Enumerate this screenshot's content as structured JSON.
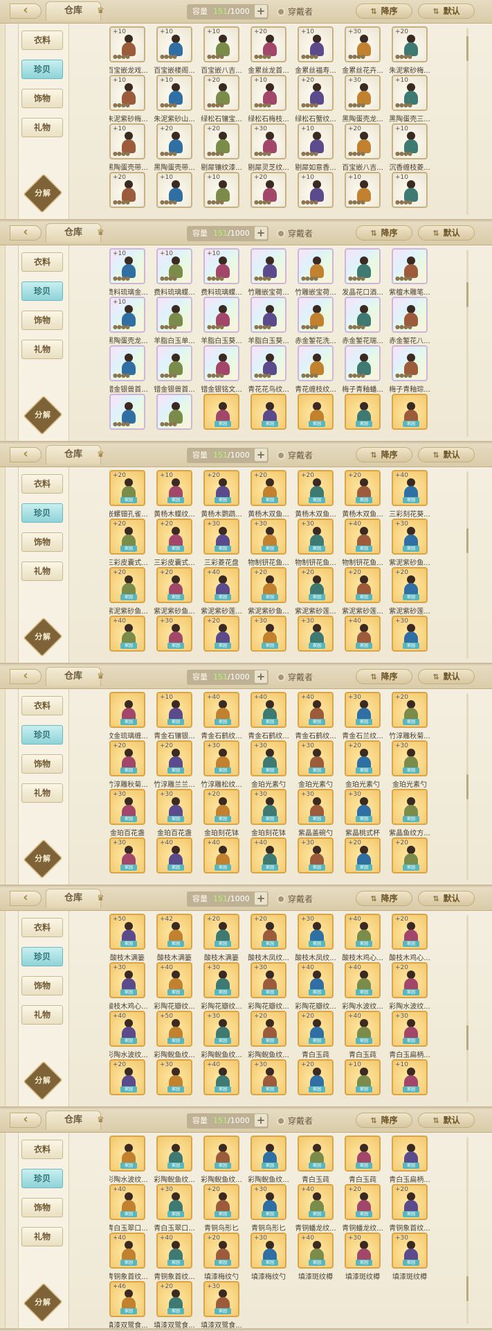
{
  "ui": {
    "back_icon": "back-arrow-icon",
    "title": "仓库",
    "capacity_label": "容量",
    "capacity_current": "151",
    "capacity_total": "/1000",
    "plus_label": "+",
    "wearer_label": "穿戴者",
    "sort_desc_label": "降序",
    "sort_default_label": "默认",
    "sort_icon": "sort-arrows-icon",
    "categories": [
      "衣料",
      "珍贝",
      "饰物",
      "礼物"
    ],
    "decompose_label": "分解",
    "tag_label": "家园"
  },
  "panels": [
    {
      "selected_category": 1,
      "scroll": 0.05,
      "rows": [
        [
          {
            "lv": "+10",
            "name": "百宝嵌龙戏...",
            "rarity": "white"
          },
          {
            "lv": "+10",
            "name": "百宝嵌楼阁...",
            "rarity": "white"
          },
          {
            "lv": "+10",
            "name": "百宝嵌八吉...",
            "rarity": "white"
          },
          {
            "lv": "+20",
            "name": "金累丝龙首...",
            "rarity": "white"
          },
          {
            "lv": "+10",
            "name": "金累丝福寿...",
            "rarity": "white"
          },
          {
            "lv": "+30",
            "name": "金累丝花卉...",
            "rarity": "white"
          },
          {
            "lv": "+20",
            "name": "朱泥紫砂梅...",
            "rarity": "white"
          }
        ],
        [
          {
            "lv": "+10",
            "name": "朱泥紫砂梅...",
            "rarity": "white"
          },
          {
            "lv": "+10",
            "name": "朱泥紫砂山...",
            "rarity": "white"
          },
          {
            "lv": "+20",
            "name": "绿松石镶宝...",
            "rarity": "white"
          },
          {
            "lv": "+10",
            "name": "绿松石梅枝...",
            "rarity": "white"
          },
          {
            "lv": "+20",
            "name": "绿松石蟹纹...",
            "rarity": "white"
          },
          {
            "lv": "+30",
            "name": "黑陶蛋壳龙...",
            "rarity": "white"
          },
          {
            "lv": "+10",
            "name": "黑陶蛋壳三...",
            "rarity": "white"
          }
        ],
        [
          {
            "lv": "+10",
            "name": "黑陶蛋壳带...",
            "rarity": "white"
          },
          {
            "lv": "+20",
            "name": "黑陶蛋壳带...",
            "rarity": "white"
          },
          {
            "lv": "+20",
            "name": "剔犀镶纹漆...",
            "rarity": "white"
          },
          {
            "lv": "+30",
            "name": "剔犀灵芝纹...",
            "rarity": "white"
          },
          {
            "lv": "+10",
            "name": "剔犀如意香...",
            "rarity": "white"
          },
          {
            "lv": "+20",
            "name": "百宝嵌八吉...",
            "rarity": "white"
          },
          {
            "lv": "+10",
            "name": "沉香缠枝菱...",
            "rarity": "white"
          }
        ],
        [
          {
            "lv": "+20",
            "name": "",
            "rarity": "white"
          },
          {
            "lv": "+10",
            "name": "",
            "rarity": "white"
          },
          {
            "lv": "+10",
            "name": "",
            "rarity": "white"
          },
          {
            "lv": "+20",
            "name": "",
            "rarity": "white"
          },
          {
            "lv": "+10",
            "name": "",
            "rarity": "white"
          },
          {
            "lv": "+10",
            "name": "",
            "rarity": "white"
          },
          {
            "lv": "+10",
            "name": "",
            "rarity": "white"
          }
        ]
      ]
    },
    {
      "selected_category": 1,
      "scroll": 0.2,
      "rows": [
        [
          {
            "lv": "+10",
            "name": "费料琉璃金...",
            "rarity": "rainbow"
          },
          {
            "lv": "+10",
            "name": "费料琉璃蝶...",
            "rarity": "rainbow"
          },
          {
            "lv": "+10",
            "name": "费料琉璃蝶...",
            "rarity": "rainbow"
          },
          {
            "lv": "",
            "name": "竹雕嵌宝荷...",
            "rarity": "rainbow"
          },
          {
            "lv": "",
            "name": "竹雕嵌宝荷...",
            "rarity": "rainbow"
          },
          {
            "lv": "",
            "name": "发晶花口酒...",
            "rarity": "rainbow"
          },
          {
            "lv": "",
            "name": "紫檀木雕笔...",
            "rarity": "rainbow"
          }
        ],
        [
          {
            "lv": "+10",
            "name": "黑陶蛋壳龙...",
            "rarity": "rainbow"
          },
          {
            "lv": "",
            "name": "羊脂白玉单...",
            "rarity": "rainbow"
          },
          {
            "lv": "",
            "name": "羊脂白玉葵...",
            "rarity": "rainbow"
          },
          {
            "lv": "",
            "name": "羊脂白玉葵...",
            "rarity": "rainbow"
          },
          {
            "lv": "",
            "name": "赤金錾花洗...",
            "rarity": "rainbow"
          },
          {
            "lv": "",
            "name": "赤金錾花瑞...",
            "rarity": "rainbow"
          },
          {
            "lv": "",
            "name": "赤金錾花八...",
            "rarity": "rainbow"
          }
        ],
        [
          {
            "lv": "",
            "name": "错金银兽首...",
            "rarity": "rainbow"
          },
          {
            "lv": "",
            "name": "错金银兽首...",
            "rarity": "rainbow"
          },
          {
            "lv": "",
            "name": "错金银铭文...",
            "rarity": "rainbow"
          },
          {
            "lv": "",
            "name": "青花花鸟纹...",
            "rarity": "rainbow"
          },
          {
            "lv": "",
            "name": "青花缠枝纹...",
            "rarity": "rainbow"
          },
          {
            "lv": "",
            "name": "梅子青釉蟠...",
            "rarity": "rainbow"
          },
          {
            "lv": "",
            "name": "梅子青釉琮...",
            "rarity": "rainbow"
          }
        ],
        [
          {
            "lv": "",
            "name": "",
            "rarity": "rainbow"
          },
          {
            "lv": "",
            "name": "",
            "rarity": "rainbow"
          },
          {
            "lv": "",
            "name": "",
            "rarity": "gold"
          },
          {
            "lv": "",
            "name": "",
            "rarity": "gold"
          },
          {
            "lv": "",
            "name": "",
            "rarity": "gold"
          },
          {
            "lv": "",
            "name": "",
            "rarity": "gold"
          },
          {
            "lv": "",
            "name": "",
            "rarity": "gold"
          }
        ]
      ]
    },
    {
      "selected_category": 1,
      "scroll": 0.35,
      "rows": [
        [
          {
            "lv": "+20",
            "name": "嵌螺钿孔雀...",
            "rarity": "gold"
          },
          {
            "lv": "+10",
            "name": "黄杨木蝶纹...",
            "rarity": "gold"
          },
          {
            "lv": "+20",
            "name": "黄杨木鹦鹉...",
            "rarity": "gold"
          },
          {
            "lv": "+20",
            "name": "黄杨木双鱼...",
            "rarity": "gold"
          },
          {
            "lv": "+20",
            "name": "黄杨木双鱼...",
            "rarity": "gold"
          },
          {
            "lv": "+20",
            "name": "黄杨木双鱼...",
            "rarity": "gold"
          },
          {
            "lv": "+40",
            "name": "三彩刻花葵...",
            "rarity": "gold"
          }
        ],
        [
          {
            "lv": "+20",
            "name": "三彩皮囊式...",
            "rarity": "gold"
          },
          {
            "lv": "+20",
            "name": "三彩皮囊式...",
            "rarity": "gold"
          },
          {
            "lv": "+30",
            "name": "三彩菱花盘",
            "rarity": "gold"
          },
          {
            "lv": "+30",
            "name": "物制钘花鱼...",
            "rarity": "gold"
          },
          {
            "lv": "+30",
            "name": "物制钘花鱼...",
            "rarity": "gold"
          },
          {
            "lv": "+40",
            "name": "物制钘花鱼...",
            "rarity": "gold"
          },
          {
            "lv": "+30",
            "name": "紫泥紫砂鱼...",
            "rarity": "gold"
          }
        ],
        [
          {
            "lv": "+20",
            "name": "紫泥紫砂鱼...",
            "rarity": "gold"
          },
          {
            "lv": "+20",
            "name": "紫泥紫砂鱼...",
            "rarity": "gold"
          },
          {
            "lv": "+40",
            "name": "紫泥紫砂莲...",
            "rarity": "gold"
          },
          {
            "lv": "+20",
            "name": "紫泥紫砂鱼...",
            "rarity": "gold"
          },
          {
            "lv": "+20",
            "name": "紫泥紫砂莲...",
            "rarity": "gold"
          },
          {
            "lv": "+20",
            "name": "紫泥紫砂莲...",
            "rarity": "gold"
          },
          {
            "lv": "+20",
            "name": "紫泥紫砂莲...",
            "rarity": "gold"
          }
        ],
        [
          {
            "lv": "+40",
            "name": "",
            "rarity": "gold"
          },
          {
            "lv": "+30",
            "name": "",
            "rarity": "gold"
          },
          {
            "lv": "+20",
            "name": "",
            "rarity": "gold"
          },
          {
            "lv": "+30",
            "name": "",
            "rarity": "gold"
          },
          {
            "lv": "+30",
            "name": "",
            "rarity": "gold"
          },
          {
            "lv": "+40",
            "name": "",
            "rarity": "gold"
          },
          {
            "lv": "+30",
            "name": "",
            "rarity": "gold"
          }
        ]
      ]
    },
    {
      "selected_category": 1,
      "scroll": 0.5,
      "rows": [
        [
          {
            "lv": "",
            "name": "纹金琉璃缠...",
            "rarity": "gold"
          },
          {
            "lv": "+10",
            "name": "青金石镶银...",
            "rarity": "gold"
          },
          {
            "lv": "+40",
            "name": "青金石鹤纹...",
            "rarity": "gold"
          },
          {
            "lv": "+40",
            "name": "青金石鹤纹...",
            "rarity": "gold"
          },
          {
            "lv": "+40",
            "name": "青金石鹤纹...",
            "rarity": "gold"
          },
          {
            "lv": "+30",
            "name": "青金石兰纹...",
            "rarity": "gold"
          },
          {
            "lv": "+20",
            "name": "竹淳雕秋菊...",
            "rarity": "gold"
          }
        ],
        [
          {
            "lv": "+20",
            "name": "竹淳雕秋菊...",
            "rarity": "gold"
          },
          {
            "lv": "+20",
            "name": "竹淳雕兰兰...",
            "rarity": "gold"
          },
          {
            "lv": "+30",
            "name": "竹淳雕松纹...",
            "rarity": "gold"
          },
          {
            "lv": "+30",
            "name": "金珀光素勺",
            "rarity": "gold"
          },
          {
            "lv": "+30",
            "name": "金珀光素勺",
            "rarity": "gold"
          },
          {
            "lv": "+20",
            "name": "金珀光素勺",
            "rarity": "gold"
          },
          {
            "lv": "+30",
            "name": "金珀光素勺",
            "rarity": "gold"
          }
        ],
        [
          {
            "lv": "+30",
            "name": "金珀百花盏",
            "rarity": "gold"
          },
          {
            "lv": "+30",
            "name": "金珀百花盏",
            "rarity": "gold"
          },
          {
            "lv": "+20",
            "name": "金珀刻花钵",
            "rarity": "gold"
          },
          {
            "lv": "+30",
            "name": "金珀刻花钵",
            "rarity": "gold"
          },
          {
            "lv": "+30",
            "name": "紫晶盖碗勺",
            "rarity": "gold"
          },
          {
            "lv": "+30",
            "name": "紫晶桃式杯",
            "rarity": "gold"
          },
          {
            "lv": "",
            "name": "紫晶鱼纹方...",
            "rarity": "gold"
          }
        ],
        [
          {
            "lv": "+30",
            "name": "",
            "rarity": "gold"
          },
          {
            "lv": "+40",
            "name": "",
            "rarity": "gold"
          },
          {
            "lv": "+40",
            "name": "",
            "rarity": "gold"
          },
          {
            "lv": "+40",
            "name": "",
            "rarity": "gold"
          },
          {
            "lv": "+30",
            "name": "",
            "rarity": "gold"
          },
          {
            "lv": "+20",
            "name": "",
            "rarity": "gold"
          },
          {
            "lv": "+20",
            "name": "",
            "rarity": "gold"
          }
        ]
      ]
    },
    {
      "selected_category": 1,
      "scroll": 0.68,
      "rows": [
        [
          {
            "lv": "+50",
            "name": "酸枝木满篓",
            "rarity": "gold"
          },
          {
            "lv": "+42",
            "name": "酸枝木满篓",
            "rarity": "gold"
          },
          {
            "lv": "+20",
            "name": "酸枝木满篓",
            "rarity": "gold"
          },
          {
            "lv": "+20",
            "name": "酸枝木凤纹...",
            "rarity": "gold"
          },
          {
            "lv": "+30",
            "name": "酸枝木凤纹...",
            "rarity": "gold"
          },
          {
            "lv": "+40",
            "name": "酸枝木鸡心...",
            "rarity": "gold"
          },
          {
            "lv": "+20",
            "name": "酸枝木鸡心...",
            "rarity": "gold"
          }
        ],
        [
          {
            "lv": "+30",
            "name": "酸枝木鸡心...",
            "rarity": "gold"
          },
          {
            "lv": "+40",
            "name": "彩陶花瓣纹...",
            "rarity": "gold"
          },
          {
            "lv": "+30",
            "name": "彩陶花瓣纹...",
            "rarity": "gold"
          },
          {
            "lv": "+30",
            "name": "彩陶花瓣纹...",
            "rarity": "gold"
          },
          {
            "lv": "+40",
            "name": "彩陶花瓣纹...",
            "rarity": "gold"
          },
          {
            "lv": "+40",
            "name": "彩陶水波纹...",
            "rarity": "gold"
          },
          {
            "lv": "+20",
            "name": "彩陶水波纹...",
            "rarity": "gold"
          }
        ],
        [
          {
            "lv": "+40",
            "name": "彩陶水波纹...",
            "rarity": "gold"
          },
          {
            "lv": "+50",
            "name": "彩陶鲵鱼纹...",
            "rarity": "gold"
          },
          {
            "lv": "+30",
            "name": "彩陶鲵鱼纹...",
            "rarity": "gold"
          },
          {
            "lv": "+20",
            "name": "彩陶鲵鱼纹...",
            "rarity": "gold"
          },
          {
            "lv": "+20",
            "name": "青白玉莼",
            "rarity": "gold"
          },
          {
            "lv": "+40",
            "name": "青白玉莼",
            "rarity": "gold"
          },
          {
            "lv": "+30",
            "name": "青白玉扁柄...",
            "rarity": "gold"
          }
        ],
        [
          {
            "lv": "+20",
            "name": "",
            "rarity": "gold"
          },
          {
            "lv": "+30",
            "name": "",
            "rarity": "gold"
          },
          {
            "lv": "+40",
            "name": "",
            "rarity": "gold"
          },
          {
            "lv": "+30",
            "name": "",
            "rarity": "gold"
          },
          {
            "lv": "+20",
            "name": "",
            "rarity": "gold"
          },
          {
            "lv": "+10",
            "name": "",
            "rarity": "gold"
          },
          {
            "lv": "+10",
            "name": "",
            "rarity": "gold"
          }
        ]
      ]
    },
    {
      "selected_category": 1,
      "scroll": 0.86,
      "rows": [
        [
          {
            "lv": "",
            "name": "彩陶水波纹...",
            "rarity": "gold"
          },
          {
            "lv": "",
            "name": "彩陶鲵鱼纹...",
            "rarity": "gold"
          },
          {
            "lv": "",
            "name": "彩陶鲵鱼纹...",
            "rarity": "gold"
          },
          {
            "lv": "",
            "name": "彩陶鲵鱼纹...",
            "rarity": "gold"
          },
          {
            "lv": "",
            "name": "青白玉莼",
            "rarity": "gold"
          },
          {
            "lv": "",
            "name": "青白玉莼",
            "rarity": "gold"
          },
          {
            "lv": "",
            "name": "青白玉扁柄...",
            "rarity": "gold"
          }
        ],
        [
          {
            "lv": "+40",
            "name": "青白玉翠口...",
            "rarity": "gold"
          },
          {
            "lv": "+30",
            "name": "青白玉翠口...",
            "rarity": "gold"
          },
          {
            "lv": "+20",
            "name": "青铜鸟形匕",
            "rarity": "gold"
          },
          {
            "lv": "+30",
            "name": "青铜鸟形匕",
            "rarity": "gold"
          },
          {
            "lv": "+40",
            "name": "青铜蟠龙纹...",
            "rarity": "gold"
          },
          {
            "lv": "+20",
            "name": "青铜蟠龙纹...",
            "rarity": "gold"
          },
          {
            "lv": "+20",
            "name": "青铜象首纹...",
            "rarity": "gold"
          }
        ],
        [
          {
            "lv": "+40",
            "name": "青铜象首纹...",
            "rarity": "gold"
          },
          {
            "lv": "+40",
            "name": "青铜象首纹...",
            "rarity": "gold"
          },
          {
            "lv": "+20",
            "name": "填漆梅纹勺",
            "rarity": "gold"
          },
          {
            "lv": "+30",
            "name": "填漆梅纹勺",
            "rarity": "gold"
          },
          {
            "lv": "+40",
            "name": "填漆斑纹樽",
            "rarity": "gold"
          },
          {
            "lv": "+30",
            "name": "填漆斑纹樽",
            "rarity": "gold"
          },
          {
            "lv": "+30",
            "name": "填漆斑纹樽",
            "rarity": "gold"
          }
        ],
        [
          {
            "lv": "+46",
            "name": "填漆双鹭食...",
            "rarity": "gold"
          },
          {
            "lv": "+20",
            "name": "填漆双鹭食...",
            "rarity": "gold"
          },
          {
            "lv": "+30",
            "name": "填漆双鹭食...",
            "rarity": "gold"
          }
        ]
      ]
    }
  ],
  "palette": {
    "accent_teal": "#8ed3d8",
    "capacity_green": "#b5f27a",
    "card_gold": "#f3c76c",
    "panel_bg": "#f4efe1"
  }
}
